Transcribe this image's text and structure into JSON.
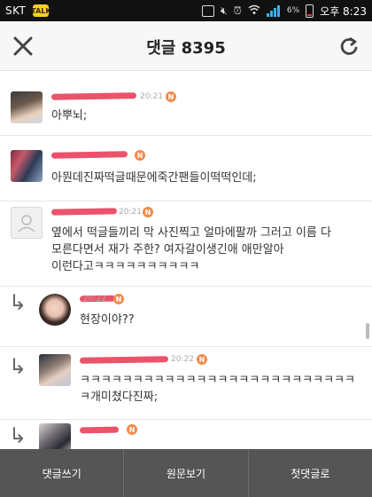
{
  "status_bar": {
    "carrier": "SKT",
    "battery": "6%",
    "time": "오후 8:23",
    "icons": [
      "kakaotalk-icon",
      "screen-icon",
      "mute-icon",
      "alarm-icon",
      "wifi-icon",
      "signal-icon",
      "battery-icon"
    ]
  },
  "header": {
    "title": "댓글 8395",
    "close_icon": "close-icon",
    "refresh_icon": "refresh-icon"
  },
  "comments": [
    {
      "time": "20:21",
      "text": "아뿌뇌;",
      "reply": false
    },
    {
      "time": "",
      "text": "아뭔데진짜떡글때문에죽간팬들이떡떡인데;",
      "reply": false
    },
    {
      "time": "20:21",
      "text": "옆에서 떡글들끼리 막 사진찍고 얼마에팔까 그러고 이름 다\n모른다면서 재가 주한? 여자갈이생긴애 애만알아\n이런다고ㅋㅋㅋㅋㅋㅋㅋㅋㅋㅋ",
      "reply": false
    },
    {
      "time": "20:22",
      "text": "현장이야??",
      "reply": true
    },
    {
      "time": "20:22",
      "text": "ㅋㅋㅋㅋㅋㅋㅋㅋㅋㅋㅋㅋㅋㅋㅋㅋㅋㅋㅋㅋㅋㅋㅋㅋㅋㅋ\nㅋ개미쳤다진짜;",
      "reply": true
    },
    {
      "time": "",
      "text": "",
      "reply": true
    }
  ],
  "badge_label": "N",
  "bottom_tabs": [
    "댓글쓰기",
    "원문보기",
    "첫댓글로"
  ],
  "colors": {
    "scribble": "#e8405a",
    "badge": "#f28a4a",
    "bottom_bar": "#555555"
  }
}
